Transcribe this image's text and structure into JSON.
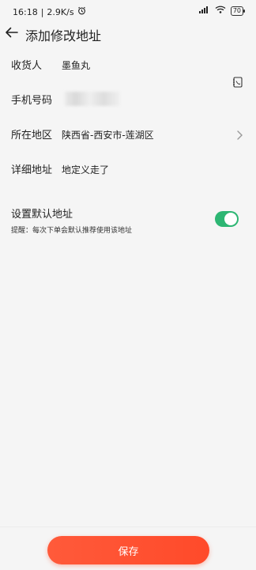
{
  "status": {
    "time": "16:18",
    "speed": "2.9K/s",
    "battery": "70"
  },
  "header": {
    "title": "添加修改地址"
  },
  "form": {
    "recipient_label": "收货人",
    "recipient_value": "墨鱼丸",
    "phone_label": "手机号码",
    "region_label": "所在地区",
    "region_value": "陕西省-西安市-莲湖区",
    "detail_label": "详细地址",
    "detail_value": "地定义走了"
  },
  "default_address": {
    "label": "设置默认地址",
    "hint": "提醒：每次下单会默认推荐使用该地址",
    "enabled": true
  },
  "footer": {
    "save_label": "保存"
  },
  "colors": {
    "accent": "#ff4a2a",
    "toggle_on": "#2db673"
  }
}
